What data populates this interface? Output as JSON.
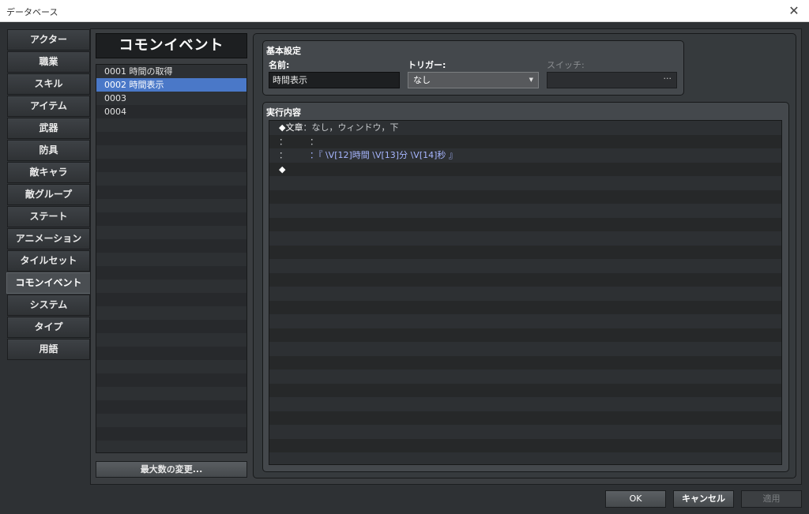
{
  "window": {
    "title": "データベース",
    "close_glyph": "✕"
  },
  "nav": {
    "items": [
      {
        "label": "アクター",
        "active": false
      },
      {
        "label": "職業",
        "active": false
      },
      {
        "label": "スキル",
        "active": false
      },
      {
        "label": "アイテム",
        "active": false
      },
      {
        "label": "武器",
        "active": false
      },
      {
        "label": "防具",
        "active": false
      },
      {
        "label": "敵キャラ",
        "active": false
      },
      {
        "label": "敵グループ",
        "active": false
      },
      {
        "label": "ステート",
        "active": false
      },
      {
        "label": "アニメーション",
        "active": false
      },
      {
        "label": "タイルセット",
        "active": false
      },
      {
        "label": "コモンイベント",
        "active": true
      },
      {
        "label": "システム",
        "active": false
      },
      {
        "label": "タイプ",
        "active": false
      },
      {
        "label": "用語",
        "active": false
      }
    ]
  },
  "event_list": {
    "header": "コモンイベント",
    "items": [
      {
        "label": "0001 時間の取得",
        "selected": false
      },
      {
        "label": "0002 時間表示",
        "selected": true
      },
      {
        "label": "0003",
        "selected": false
      },
      {
        "label": "0004",
        "selected": false
      }
    ],
    "max_button": "最大数の変更..."
  },
  "basic": {
    "title": "基本設定",
    "name_label": "名前:",
    "name_value": "時間表示",
    "trigger_label": "トリガー:",
    "trigger_value": "なし",
    "switch_label": "スイッチ:",
    "switch_ellipsis": "···"
  },
  "exec": {
    "title": "実行内容",
    "commands": [
      {
        "segments": [
          {
            "text": "◆",
            "color": "white"
          },
          {
            "text": "文章",
            "color": "white"
          },
          {
            "text": "：なし，ウィンドウ，下",
            "color": "gray"
          }
        ]
      },
      {
        "segments": [
          {
            "text": "：",
            "color": "gray"
          },
          {
            "text": "        ：",
            "color": "gray"
          }
        ]
      },
      {
        "segments": [
          {
            "text": "：",
            "color": "gray"
          },
          {
            "text": "        ：『 \\V[12]時間 \\V[13]分 \\V[14]秒 』",
            "color": "blue"
          }
        ]
      },
      {
        "segments": [
          {
            "text": "◆",
            "color": "white"
          }
        ]
      }
    ]
  },
  "buttons": {
    "ok": "OK",
    "cancel": "キャンセル",
    "apply": "適用"
  },
  "colors": {
    "selection": "#4a78c8",
    "param_text": "#a7b6ff",
    "background": "#2e3134"
  }
}
